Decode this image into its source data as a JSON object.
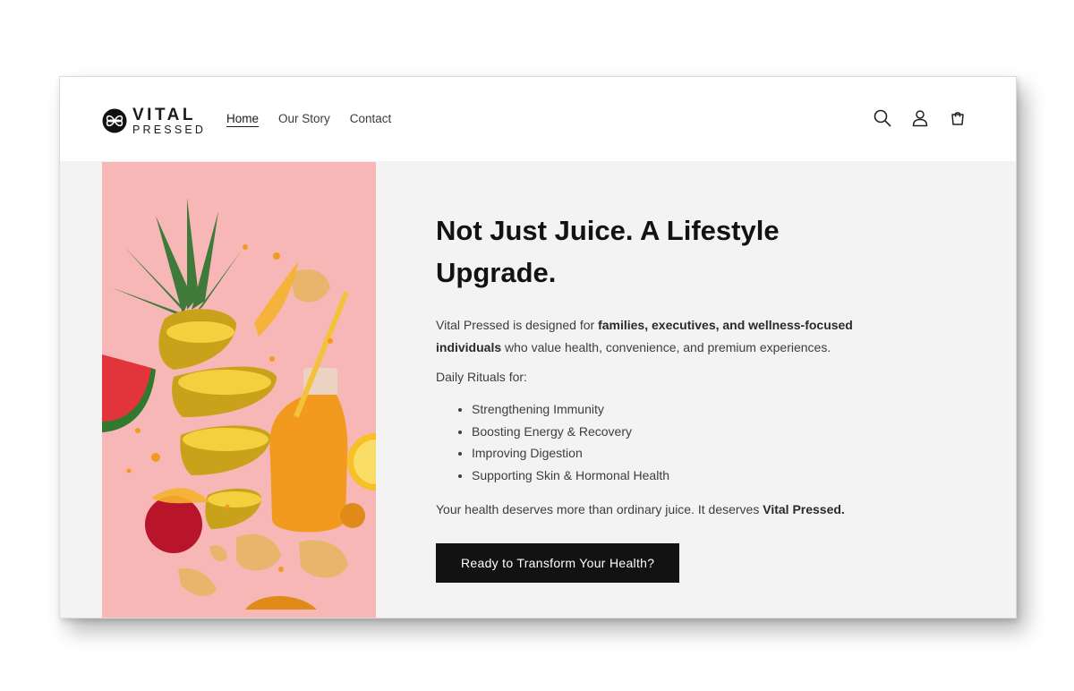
{
  "brand": {
    "name_line1": "VITAL",
    "name_line2": "PRESSED"
  },
  "nav": {
    "items": [
      {
        "label": "Home",
        "active": true
      },
      {
        "label": "Our Story",
        "active": false
      },
      {
        "label": "Contact",
        "active": false
      }
    ]
  },
  "header_icons": [
    "search-icon",
    "account-icon",
    "cart-icon"
  ],
  "hero": {
    "image": "juice-splash-photo",
    "headline": "Not Just Juice. A Lifestyle Upgrade.",
    "intro": {
      "text1": "Vital Pressed is designed for ",
      "bold": "families, executives, and wellness-focused individuals",
      "text2": " who value health, convenience, and premium experiences."
    },
    "rituals_label": "Daily Rituals for:",
    "rituals": [
      "Strengthening Immunity",
      "Boosting Energy & Recovery",
      "Improving Digestion",
      "Supporting Skin & Hormonal Health"
    ],
    "closing": {
      "text": "Your health deserves more than ordinary juice. It deserves ",
      "bold": "Vital Pressed."
    },
    "cta_label": "Ready to Transform Your Health?"
  },
  "colors": {
    "page_bg": "#ffffff",
    "panel_bg": "#f3f3f3",
    "hero_pink": "#f7b7b6",
    "button_bg": "#121212"
  }
}
